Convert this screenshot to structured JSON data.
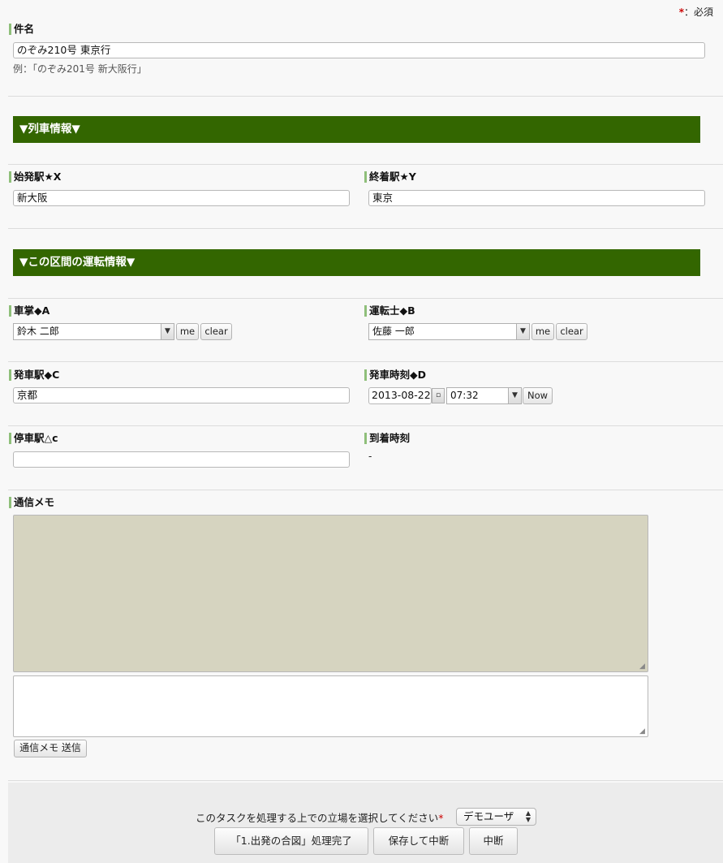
{
  "header": {
    "required_star": "*",
    "required_text": "：必須"
  },
  "subject": {
    "label": "件名",
    "value": "のぞみ210号 東京行",
    "example": "例：「のぞみ201号 新大阪行」"
  },
  "sections": {
    "train_info": "▼列車情報▼",
    "segment_info": "▼この区間の運転情報▼"
  },
  "departure_station": {
    "label": "始発駅★X",
    "value": "新大阪"
  },
  "arrival_terminal": {
    "label": "終着駅★Y",
    "value": "東京"
  },
  "conductor": {
    "label": "車掌◆A",
    "value": "鈴木 二郎",
    "me": "me",
    "clear": "clear"
  },
  "driver": {
    "label": "運転士◆B",
    "value": "佐藤 一郎",
    "me": "me",
    "clear": "clear"
  },
  "departure_stop": {
    "label": "発車駅◆C",
    "value": "京都"
  },
  "departure_time": {
    "label": "発車時刻◆D",
    "date": "2013-08-22",
    "time": "07:32",
    "now": "Now"
  },
  "stop_station": {
    "label": "停車駅△c",
    "value": ""
  },
  "arrival_time": {
    "label": "到着時刻",
    "value": "-"
  },
  "memo": {
    "label": "通信メモ",
    "send_button": "通信メモ 送信",
    "log": "",
    "input": ""
  },
  "footer": {
    "prompt": "このタスクを処理する上での立場を選択してください",
    "required_star": "*",
    "role": "デモユーザ",
    "buttons": {
      "complete": "「1.出発の合図」処理完了",
      "save_suspend": "保存して中断",
      "suspend": "中断"
    }
  },
  "colors": {
    "section_bg": "#336600",
    "label_bar": "#8fbf7a",
    "memo_log_bg": "#d6d4c0"
  }
}
